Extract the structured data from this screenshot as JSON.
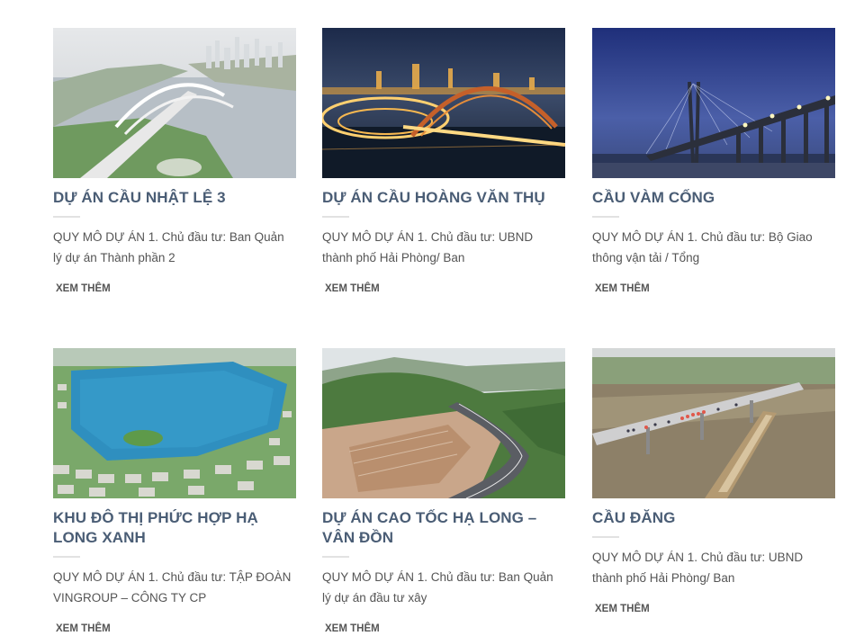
{
  "projects": [
    {
      "title": "DỰ ÁN CẦU NHẬT LỆ 3",
      "excerpt": "QUY MÔ DỰ ÁN 1. Chủ đầu tư: Ban Quản lý dự án Thành phần 2",
      "more": "XEM THÊM"
    },
    {
      "title": "DỰ ÁN CẦU HOÀNG VĂN THỤ",
      "excerpt": "QUY MÔ DỰ ÁN 1. Chủ đầu tư: UBND thành phố Hải Phòng/ Ban",
      "more": "XEM THÊM"
    },
    {
      "title": "CẦU VÀM CỐNG",
      "excerpt": "QUY MÔ DỰ ÁN 1. Chủ đầu tư: Bộ Giao thông vận tải / Tổng",
      "more": "XEM THÊM"
    },
    {
      "title": "KHU ĐÔ THỊ PHỨC HỢP HẠ LONG XANH",
      "excerpt": "QUY MÔ DỰ ÁN 1. Chủ đầu tư: TẬP ĐOÀN VINGROUP – CÔNG TY CP",
      "more": "XEM THÊM"
    },
    {
      "title": "DỰ ÁN CAO TỐC HẠ LONG – VÂN ĐỒN",
      "excerpt": "QUY MÔ DỰ ÁN 1. Chủ đầu tư: Ban Quản lý dự án đầu tư xây",
      "more": "XEM THÊM"
    },
    {
      "title": "CẦU ĐĂNG",
      "excerpt": "QUY MÔ DỰ ÁN 1. Chủ đầu tư: UBND thành phố Hải Phòng/ Ban",
      "more": "XEM THÊM"
    }
  ]
}
